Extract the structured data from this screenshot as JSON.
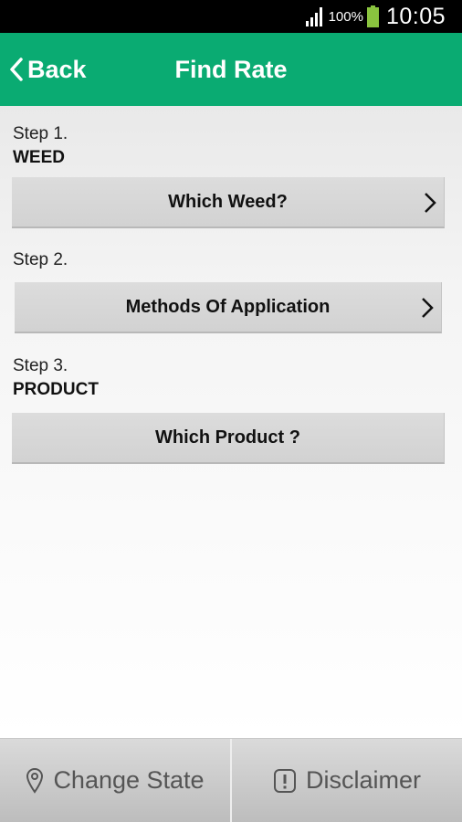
{
  "status_bar": {
    "battery_percent": "100%",
    "time": "10:05"
  },
  "header": {
    "back_label": "Back",
    "title": "Find Rate"
  },
  "steps": [
    {
      "label": "Step 1.",
      "title": "WEED",
      "button": "Which Weed?"
    },
    {
      "label": "Step 2.",
      "title": "",
      "button": "Methods Of Application"
    },
    {
      "label": "Step 3.",
      "title": "PRODUCT",
      "button": "Which Product ?"
    }
  ],
  "bottom_bar": {
    "change_state_label": "Change State",
    "disclaimer_label": "Disclaimer"
  },
  "colors": {
    "header_green": "#0aab72",
    "status_bar": "#000000",
    "battery_green": "#8ac43f"
  },
  "icons": [
    "signal-icon",
    "battery-icon",
    "chevron-left-icon",
    "chevron-right-icon",
    "location-pin-icon",
    "exclamation-icon"
  ]
}
